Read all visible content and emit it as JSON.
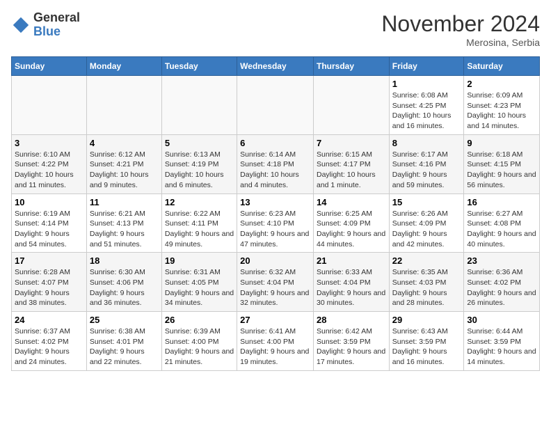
{
  "logo": {
    "general": "General",
    "blue": "Blue"
  },
  "title": "November 2024",
  "location": "Merosina, Serbia",
  "days_of_week": [
    "Sunday",
    "Monday",
    "Tuesday",
    "Wednesday",
    "Thursday",
    "Friday",
    "Saturday"
  ],
  "weeks": [
    [
      {
        "day": "",
        "info": ""
      },
      {
        "day": "",
        "info": ""
      },
      {
        "day": "",
        "info": ""
      },
      {
        "day": "",
        "info": ""
      },
      {
        "day": "",
        "info": ""
      },
      {
        "day": "1",
        "info": "Sunrise: 6:08 AM\nSunset: 4:25 PM\nDaylight: 10 hours and 16 minutes."
      },
      {
        "day": "2",
        "info": "Sunrise: 6:09 AM\nSunset: 4:23 PM\nDaylight: 10 hours and 14 minutes."
      }
    ],
    [
      {
        "day": "3",
        "info": "Sunrise: 6:10 AM\nSunset: 4:22 PM\nDaylight: 10 hours and 11 minutes."
      },
      {
        "day": "4",
        "info": "Sunrise: 6:12 AM\nSunset: 4:21 PM\nDaylight: 10 hours and 9 minutes."
      },
      {
        "day": "5",
        "info": "Sunrise: 6:13 AM\nSunset: 4:19 PM\nDaylight: 10 hours and 6 minutes."
      },
      {
        "day": "6",
        "info": "Sunrise: 6:14 AM\nSunset: 4:18 PM\nDaylight: 10 hours and 4 minutes."
      },
      {
        "day": "7",
        "info": "Sunrise: 6:15 AM\nSunset: 4:17 PM\nDaylight: 10 hours and 1 minute."
      },
      {
        "day": "8",
        "info": "Sunrise: 6:17 AM\nSunset: 4:16 PM\nDaylight: 9 hours and 59 minutes."
      },
      {
        "day": "9",
        "info": "Sunrise: 6:18 AM\nSunset: 4:15 PM\nDaylight: 9 hours and 56 minutes."
      }
    ],
    [
      {
        "day": "10",
        "info": "Sunrise: 6:19 AM\nSunset: 4:14 PM\nDaylight: 9 hours and 54 minutes."
      },
      {
        "day": "11",
        "info": "Sunrise: 6:21 AM\nSunset: 4:13 PM\nDaylight: 9 hours and 51 minutes."
      },
      {
        "day": "12",
        "info": "Sunrise: 6:22 AM\nSunset: 4:11 PM\nDaylight: 9 hours and 49 minutes."
      },
      {
        "day": "13",
        "info": "Sunrise: 6:23 AM\nSunset: 4:10 PM\nDaylight: 9 hours and 47 minutes."
      },
      {
        "day": "14",
        "info": "Sunrise: 6:25 AM\nSunset: 4:09 PM\nDaylight: 9 hours and 44 minutes."
      },
      {
        "day": "15",
        "info": "Sunrise: 6:26 AM\nSunset: 4:09 PM\nDaylight: 9 hours and 42 minutes."
      },
      {
        "day": "16",
        "info": "Sunrise: 6:27 AM\nSunset: 4:08 PM\nDaylight: 9 hours and 40 minutes."
      }
    ],
    [
      {
        "day": "17",
        "info": "Sunrise: 6:28 AM\nSunset: 4:07 PM\nDaylight: 9 hours and 38 minutes."
      },
      {
        "day": "18",
        "info": "Sunrise: 6:30 AM\nSunset: 4:06 PM\nDaylight: 9 hours and 36 minutes."
      },
      {
        "day": "19",
        "info": "Sunrise: 6:31 AM\nSunset: 4:05 PM\nDaylight: 9 hours and 34 minutes."
      },
      {
        "day": "20",
        "info": "Sunrise: 6:32 AM\nSunset: 4:04 PM\nDaylight: 9 hours and 32 minutes."
      },
      {
        "day": "21",
        "info": "Sunrise: 6:33 AM\nSunset: 4:04 PM\nDaylight: 9 hours and 30 minutes."
      },
      {
        "day": "22",
        "info": "Sunrise: 6:35 AM\nSunset: 4:03 PM\nDaylight: 9 hours and 28 minutes."
      },
      {
        "day": "23",
        "info": "Sunrise: 6:36 AM\nSunset: 4:02 PM\nDaylight: 9 hours and 26 minutes."
      }
    ],
    [
      {
        "day": "24",
        "info": "Sunrise: 6:37 AM\nSunset: 4:02 PM\nDaylight: 9 hours and 24 minutes."
      },
      {
        "day": "25",
        "info": "Sunrise: 6:38 AM\nSunset: 4:01 PM\nDaylight: 9 hours and 22 minutes."
      },
      {
        "day": "26",
        "info": "Sunrise: 6:39 AM\nSunset: 4:00 PM\nDaylight: 9 hours and 21 minutes."
      },
      {
        "day": "27",
        "info": "Sunrise: 6:41 AM\nSunset: 4:00 PM\nDaylight: 9 hours and 19 minutes."
      },
      {
        "day": "28",
        "info": "Sunrise: 6:42 AM\nSunset: 3:59 PM\nDaylight: 9 hours and 17 minutes."
      },
      {
        "day": "29",
        "info": "Sunrise: 6:43 AM\nSunset: 3:59 PM\nDaylight: 9 hours and 16 minutes."
      },
      {
        "day": "30",
        "info": "Sunrise: 6:44 AM\nSunset: 3:59 PM\nDaylight: 9 hours and 14 minutes."
      }
    ]
  ]
}
